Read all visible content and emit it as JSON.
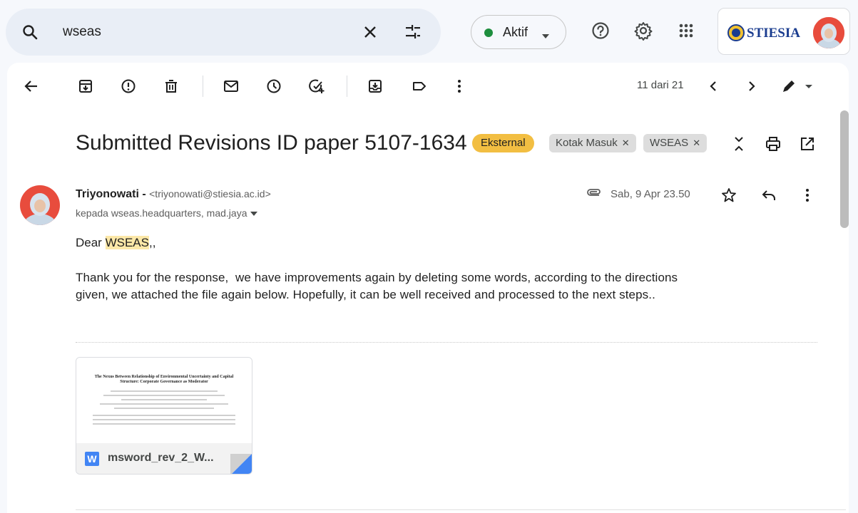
{
  "search": {
    "value": "wseas",
    "icons": [
      "search-icon",
      "clear-icon",
      "tune-icon"
    ]
  },
  "status": {
    "label": "Aktif",
    "color": "#1e8e3e"
  },
  "header_icons": [
    "help-icon",
    "settings-icon",
    "apps-icon"
  ],
  "account": {
    "logo_text": "STIESIA",
    "logo_color": "#1a3c8f"
  },
  "toolbar": {
    "icons": [
      "back-icon",
      "archive-icon",
      "report-spam-icon",
      "delete-icon",
      "mark-unread-icon",
      "snooze-icon",
      "add-task-icon",
      "move-to-icon",
      "label-icon",
      "more-icon"
    ],
    "pager": "11 dari 21"
  },
  "message": {
    "subject": "Submitted Revisions ID paper 5107-1634",
    "external_chip": "Eksternal",
    "labels": [
      "Kotak Masuk",
      "WSEAS"
    ],
    "sender_name": "Triyonowati",
    "sender_dash": " - ",
    "sender_email": "<triyonowati@stiesia.ac.id>",
    "recipients": "kepada wseas.headquarters, mad.jaya",
    "date": "Sab, 9 Apr 23.50",
    "greeting_prefix": "Dear ",
    "greeting_highlight": "WSEAS",
    "greeting_suffix": ",,",
    "body_line1": "Thank you for the response,  we have improvements again by deleting some words, according to the directions",
    "body_line2": "given, we attached the file again below. Hopefully, it can be well received and processed to the next steps.."
  },
  "attachment": {
    "filename": "msword_rev_2_W...",
    "type_badge": "W",
    "preview_title": "The Nexus Between Relationship of Environmental Uncertainty and Capital Structure: Corporate Governance as Moderator"
  },
  "colors": {
    "accent": "#0b57d0",
    "chip_external": "#f2be42",
    "highlight": "#fce8a8"
  }
}
